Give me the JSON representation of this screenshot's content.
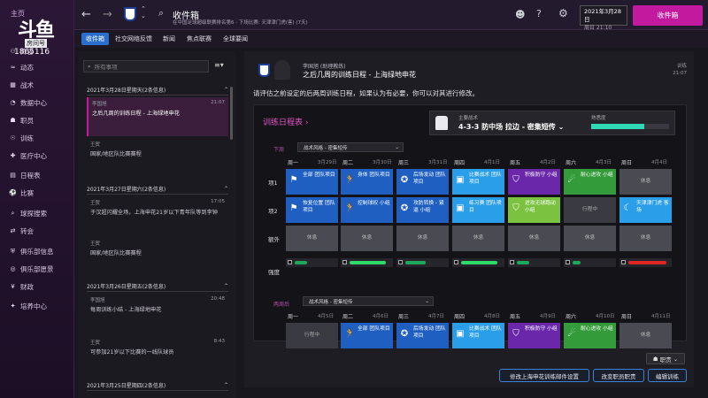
{
  "app": {
    "brand_small": "主页",
    "brand_logo": "斗鱼",
    "brand_tag": "房间号",
    "room_id": "1865116"
  },
  "nav": [
    {
      "label": "阵容",
      "icon": "people-icon"
    },
    {
      "label": "动态",
      "icon": "flow-icon"
    },
    {
      "label": "战术",
      "icon": "board-icon"
    },
    {
      "label": "数据中心",
      "icon": "chart-icon"
    },
    {
      "label": "职员",
      "icon": "staff-icon"
    },
    {
      "label": "训练",
      "icon": "whistle-icon"
    },
    {
      "label": "医疗中心",
      "icon": "medical-icon"
    },
    {
      "label": "日程表",
      "icon": "calendar-icon"
    },
    {
      "label": "比赛",
      "icon": "match-icon"
    },
    {
      "label": "球探搜索",
      "icon": "scout-icon"
    },
    {
      "label": "转会",
      "icon": "transfer-icon"
    },
    {
      "label": "俱乐部信息",
      "icon": "club-icon"
    },
    {
      "label": "俱乐部愿景",
      "icon": "vision-icon"
    },
    {
      "label": "财政",
      "icon": "finance-icon"
    },
    {
      "label": "培养中心",
      "icon": "youth-icon"
    }
  ],
  "topbar": {
    "title": "收件箱",
    "subtitle": "在中国足球超级联赛排名第6 · 下场比赛: 天津津门虎(客) (7天)",
    "date": "2021年3月28日",
    "weekday": "周日 21:10",
    "continue": "收件箱"
  },
  "subtabs": [
    "收件箱",
    "社交网络反馈",
    "新闻",
    "焦点联赛",
    "全球要闻"
  ],
  "inbox": {
    "search_placeholder": "所有事项",
    "groups": [
      {
        "label": "2021年3月28日星期天(2条信息)"
      },
      {
        "label": "2021年3月27日星期六(2条信息)"
      },
      {
        "label": "2021年3月26日星期五(2条信息)"
      },
      {
        "label": "2021年3月25日星期四(2条信息)"
      }
    ],
    "messages": [
      {
        "from": "李国旭",
        "time": "21:07",
        "subject": "之后几周的训练日程 - 上海绿地申花"
      },
      {
        "from": "王贺",
        "time": "",
        "subject": "国家/地区队比赛赛程"
      },
      {
        "from": "王贺",
        "time": "17:05",
        "subject": "于汉超闪耀全场，上海申花21岁以下青年队等到李钟"
      },
      {
        "from": "王贺",
        "time": "",
        "subject": "国家/地区队比赛赛程"
      },
      {
        "from": "李国旭",
        "time": "20:48",
        "subject": "每周训练小结 - 上海绿地申花"
      },
      {
        "from": "王贺",
        "time": "8:43",
        "subject": "可参加21岁以下比赛的一线队球员"
      }
    ]
  },
  "reading": {
    "from": "李国旭 (助理教练)",
    "subject": "之后几周的训练日程 - 上海绿地申花",
    "status": "训练",
    "time": "21:07",
    "body": "请评估之前设定的后两周训练日程，如果认为有必要，你可以对其进行修改。"
  },
  "schedule": {
    "title": "训练日程表",
    "tactic_label": "主要战术",
    "tactic_name": "4-3-3 防中场 拉边 - 密集短传",
    "familiarity_label": "熟悉度",
    "familiarity": 0.68,
    "week1": {
      "label": "下周",
      "select": "战术风格 - 密集短传",
      "days": [
        {
          "name": "周一",
          "date": "3月29日"
        },
        {
          "name": "周二",
          "date": "3月30日"
        },
        {
          "name": "周三",
          "date": "3月31日"
        },
        {
          "name": "周四",
          "date": "4月1日"
        },
        {
          "name": "周五",
          "date": "4月2日"
        },
        {
          "name": "周六",
          "date": "4月3日"
        },
        {
          "name": "周日",
          "date": "4月4日"
        }
      ],
      "row_labels": [
        "项1",
        "项2",
        "额外",
        "强度"
      ],
      "row1": [
        "全部 团队项目",
        "身体 团队项目",
        "后场发动 团队项目",
        "比赛战术 团队项目",
        "积极防守 小组",
        "耐心进攻 小组",
        "休息"
      ],
      "row2": [
        "恢复位置 团队项目",
        "控制球权 小组",
        "攻防转换 - 紧逼 小组",
        "练习赛 团队项目",
        "进攻无球跑动 小组",
        "行程中",
        "天津津门虎 客场"
      ],
      "extra": [
        "休息",
        "休息",
        "休息",
        "休息",
        "休息",
        "休息",
        "休息"
      ],
      "intensity": [
        0.3,
        0.9,
        0.5,
        0.9,
        0.3,
        0.2,
        0.95
      ]
    },
    "week2": {
      "label": "两周后",
      "select": "战术风格 - 密集短传",
      "days": [
        {
          "name": "周一",
          "date": "4月5日"
        },
        {
          "name": "周二",
          "date": "4月6日"
        },
        {
          "name": "周三",
          "date": "4月7日"
        },
        {
          "name": "周四",
          "date": "4月8日"
        },
        {
          "name": "周五",
          "date": "4月9日"
        },
        {
          "name": "周六",
          "date": "4月10日"
        },
        {
          "name": "周日",
          "date": "4月11日"
        }
      ],
      "row1": [
        "行程中",
        "全部 团队项目",
        "后场发动 团队项目",
        "比赛战术 团队项目",
        "积极防守 小组",
        "耐心进攻 小组",
        "休息"
      ]
    }
  },
  "footer": {
    "role": "职责",
    "buttons": [
      "修改上海申花训练邮件设置",
      "改变职员职责",
      "编辑训练"
    ]
  },
  "colors": {
    "accent": "#c3199e",
    "blue": "#1f5fc2",
    "cyan": "#2a9ee8",
    "purple": "#6a27a9",
    "green": "#339b3a"
  }
}
